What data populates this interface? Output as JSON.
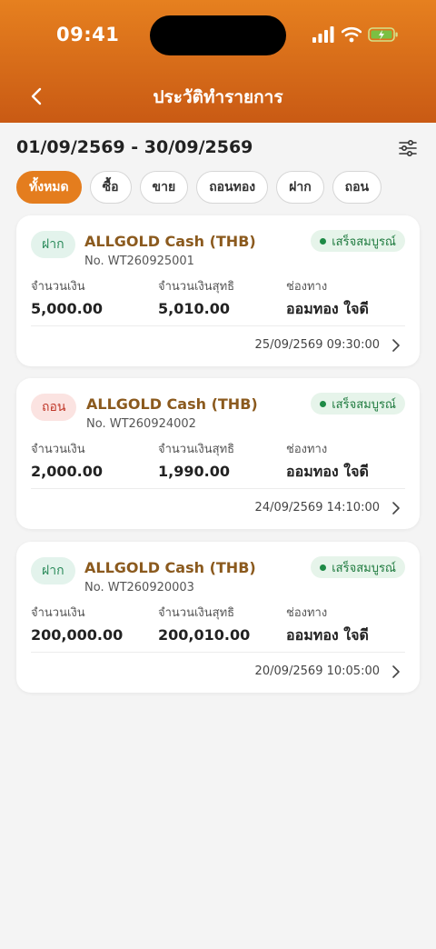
{
  "status_bar": {
    "time": "09:41"
  },
  "header": {
    "title": "ประวัติทำรายการ"
  },
  "date_range": "01/09/2569 - 30/09/2569",
  "filters": [
    {
      "label": "ทั้งหมด",
      "active": true
    },
    {
      "label": "ซื้อ",
      "active": false
    },
    {
      "label": "ขาย",
      "active": false
    },
    {
      "label": "ถอนทอง",
      "active": false
    },
    {
      "label": "ฝาก",
      "active": false
    },
    {
      "label": "ถอน",
      "active": false
    }
  ],
  "columns": {
    "amount": "จำนวนเงิน",
    "net_amount": "จำนวนเงินสุทธิ",
    "channel": "ช่องทาง"
  },
  "transactions": [
    {
      "type": "ฝาก",
      "type_kind": "deposit",
      "product": "ALLGOLD Cash (THB)",
      "number": "No. WT260925001",
      "status": "เสร็จสมบูรณ์",
      "amount": "5,000.00",
      "net_amount": "5,010.00",
      "channel": "ออมทอง ใจดี",
      "datetime": "25/09/2569 09:30:00"
    },
    {
      "type": "ถอน",
      "type_kind": "withdraw",
      "product": "ALLGOLD Cash (THB)",
      "number": "No. WT260924002",
      "status": "เสร็จสมบูรณ์",
      "amount": "2,000.00",
      "net_amount": "1,990.00",
      "channel": "ออมทอง ใจดี",
      "datetime": "24/09/2569 14:10:00"
    },
    {
      "type": "ฝาก",
      "type_kind": "deposit",
      "product": "ALLGOLD Cash (THB)",
      "number": "No. WT260920003",
      "status": "เสร็จสมบูรณ์",
      "amount": "200,000.00",
      "net_amount": "200,010.00",
      "channel": "ออมทอง ใจดี",
      "datetime": "20/09/2569 10:05:00"
    }
  ],
  "colors": {
    "accent": "#e47d1e",
    "status_green": "#1e7a3e",
    "product_brown": "#8b5a1e"
  }
}
